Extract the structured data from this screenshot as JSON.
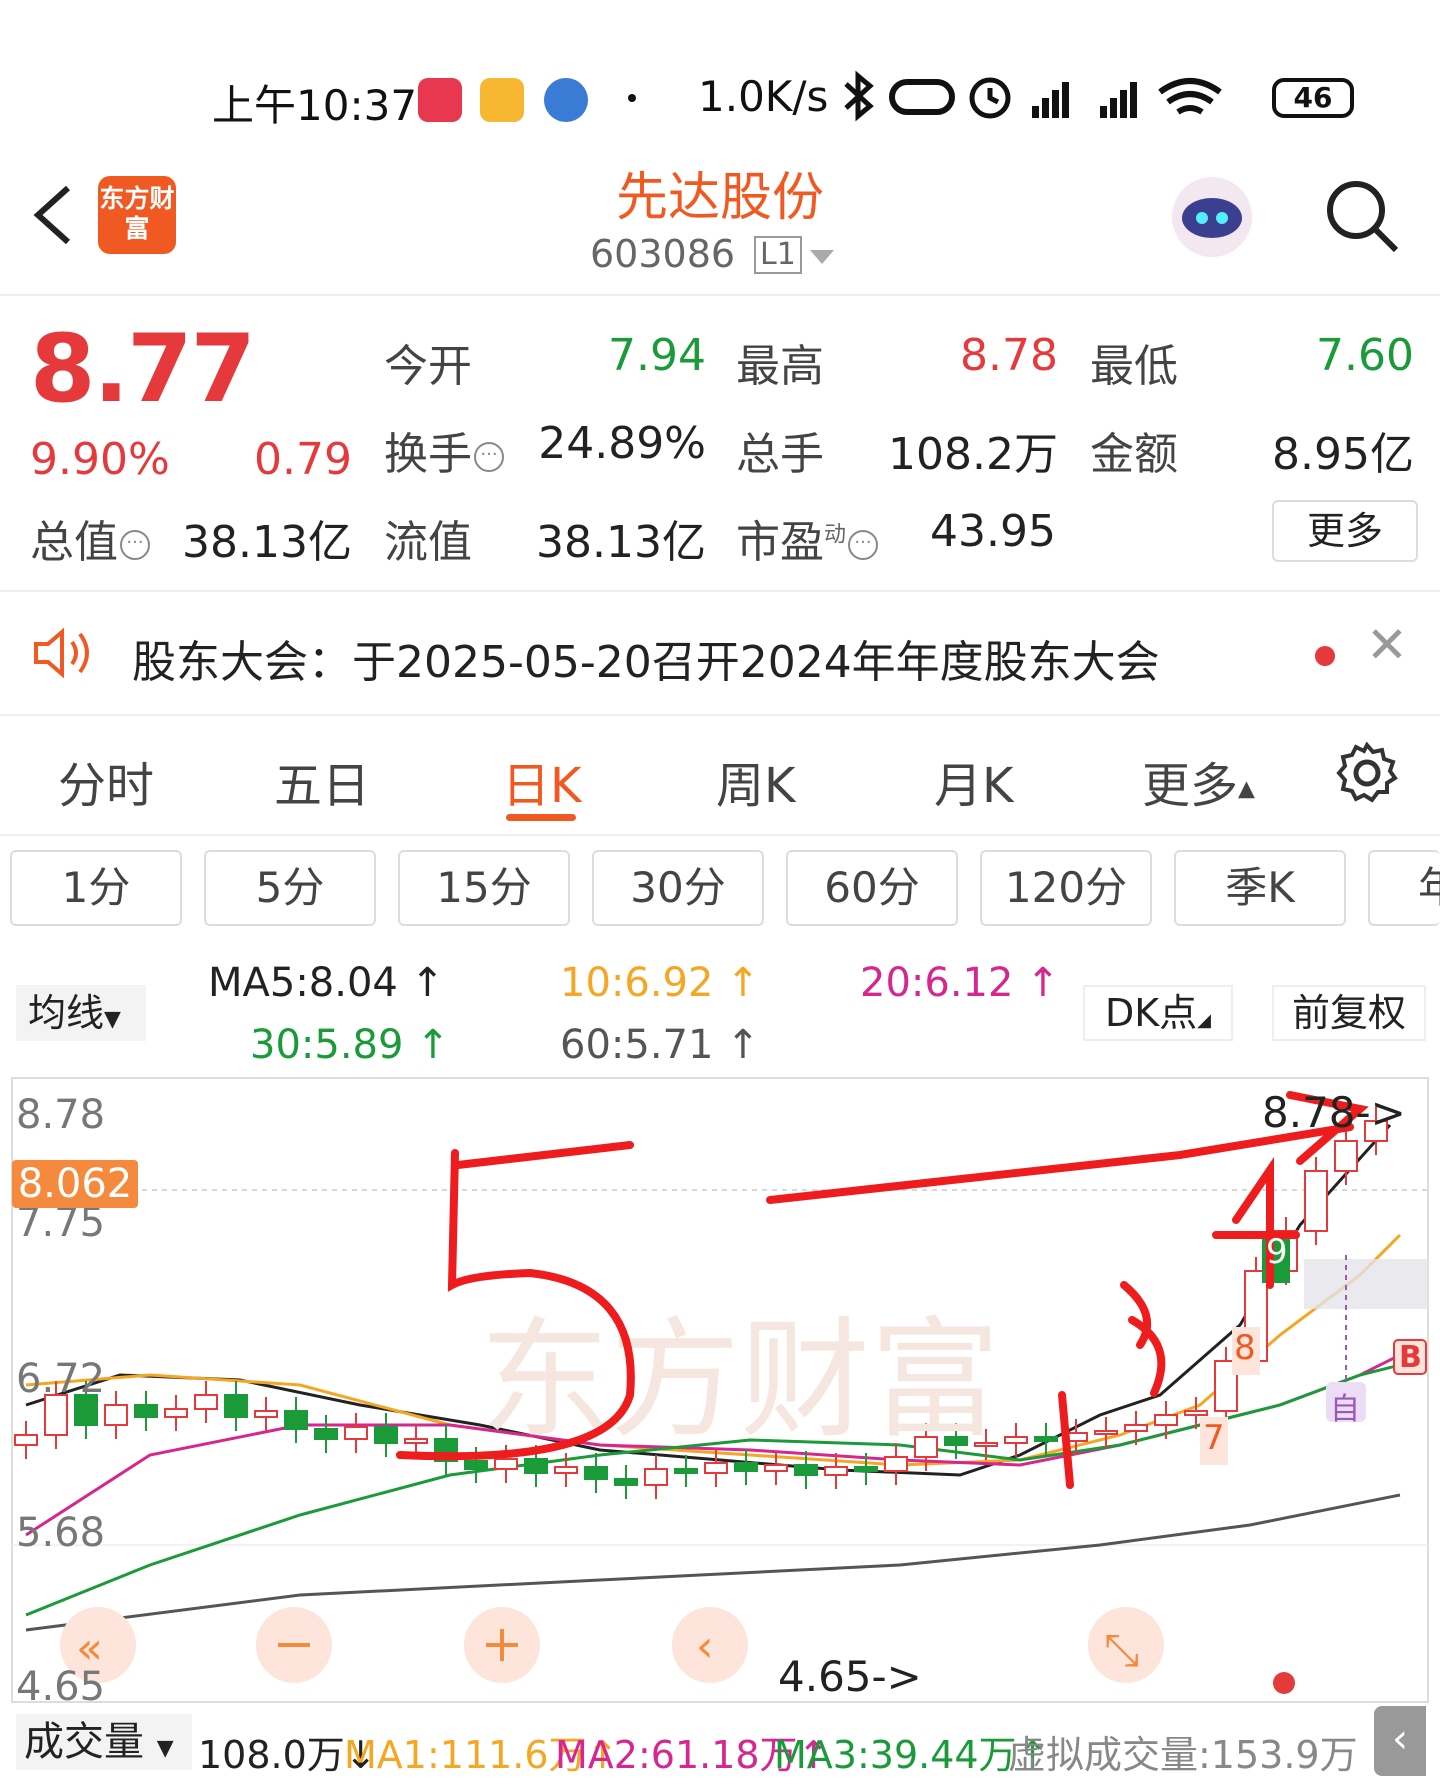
{
  "status_bar": {
    "time": "上午10:37",
    "net_speed": "1.0K/s",
    "battery": "46"
  },
  "header": {
    "app_logo": "东方财富",
    "stock_name": "先达股份",
    "stock_code": "603086",
    "level": "L1"
  },
  "quote": {
    "price": "8.77",
    "change_pct": "9.90%",
    "change_abs": "0.79",
    "fields": [
      {
        "label": "今开",
        "value": "7.94",
        "color": "green"
      },
      {
        "label": "最高",
        "value": "8.78",
        "color": "red"
      },
      {
        "label": "最低",
        "value": "7.60",
        "color": "green"
      },
      {
        "label": "换手",
        "value": "24.89%",
        "color": "normal"
      },
      {
        "label": "总手",
        "value": "108.2万",
        "color": "normal"
      },
      {
        "label": "金额",
        "value": "8.95亿",
        "color": "normal"
      },
      {
        "label": "总值",
        "value": "38.13亿",
        "color": "normal"
      },
      {
        "label": "流值",
        "value": "38.13亿",
        "color": "normal"
      },
      {
        "label": "市盈",
        "value": "43.95",
        "color": "normal"
      }
    ],
    "pe_superscript": "动",
    "more": "更多"
  },
  "notice": {
    "text": "股东大会：于2025-05-20召开2024年年度股东大会"
  },
  "tabs": [
    "分时",
    "五日",
    "日K",
    "周K",
    "月K",
    "更多"
  ],
  "active_tab": "日K",
  "periods": [
    "1分",
    "5分",
    "15分",
    "30分",
    "60分",
    "120分",
    "季K",
    "年"
  ],
  "ma_legend": {
    "selector": "均线",
    "ma5": "MA5:8.04",
    "ma10": "10:6.92",
    "ma20": "20:6.12",
    "ma30": "30:5.89",
    "ma60": "60:5.71",
    "dk": "DK点",
    "fq": "前复权"
  },
  "chart": {
    "y_labels": [
      "8.78",
      "7.75",
      "6.72",
      "5.68",
      "4.65"
    ],
    "current_price_tag": "8.062",
    "high_annotation": "8.78->",
    "low_annotation": "4.65->",
    "signal_labels": [
      "9",
      "8",
      "7",
      "B",
      "自"
    ],
    "colors": {
      "up": "#e5393c",
      "down": "#1a9a38",
      "ma5": "#222222",
      "ma10": "#f5a623",
      "ma20": "#d6268f",
      "ma30": "#1a9a38",
      "ma60": "#555555"
    }
  },
  "volume": {
    "selector": "成交量",
    "value": "108.0万",
    "ma1": "MA1:111.6万",
    "ma2": "MA2:61.18万",
    "ma3": "MA3:39.44万",
    "virtual": "虚拟成交量:153.9万"
  }
}
